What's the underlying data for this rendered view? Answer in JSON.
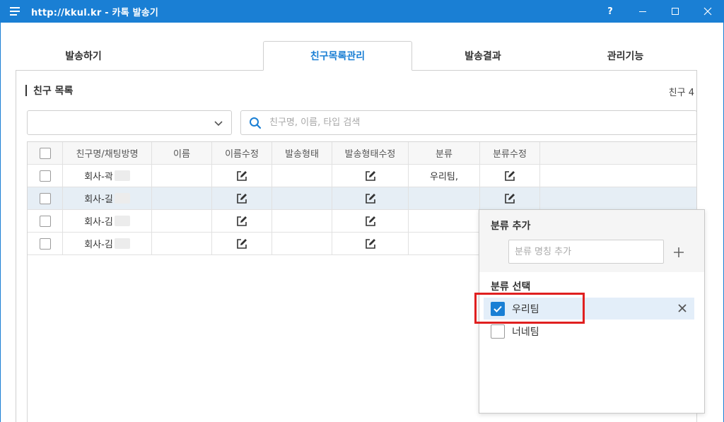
{
  "window": {
    "title": "http://kkul.kr  -  카톡 발송기",
    "help": "?",
    "accent_color": "#1a7fd4"
  },
  "tabs": [
    {
      "label": "발송하기",
      "active": false
    },
    {
      "label": "친구목록관리",
      "active": true
    },
    {
      "label": "발송결과",
      "active": false
    },
    {
      "label": "관리기능",
      "active": false
    }
  ],
  "friends": {
    "section_title": "친구 목록",
    "count_label": "친구 4",
    "dropdown_value": "",
    "search_placeholder": "친구명, 이름, 타입 검색",
    "columns": [
      "친구명/채팅방명",
      "이름",
      "이름수정",
      "발송형태",
      "발송형태수정",
      "분류",
      "분류수정"
    ],
    "rows": [
      {
        "name": "회사-곽",
        "category": "우리팀,",
        "selected": false
      },
      {
        "name": "회사-길",
        "category": "",
        "selected": true
      },
      {
        "name": "회사-김",
        "category": "",
        "selected": false
      },
      {
        "name": "회사-김",
        "category": "",
        "selected": false
      }
    ]
  },
  "category_popup": {
    "add_title": "분류 추가",
    "add_placeholder": "분류 명칭 추가",
    "select_title": "분류 선택",
    "items": [
      {
        "label": "우리팀",
        "checked": true
      },
      {
        "label": "너네팀",
        "checked": false
      }
    ]
  }
}
